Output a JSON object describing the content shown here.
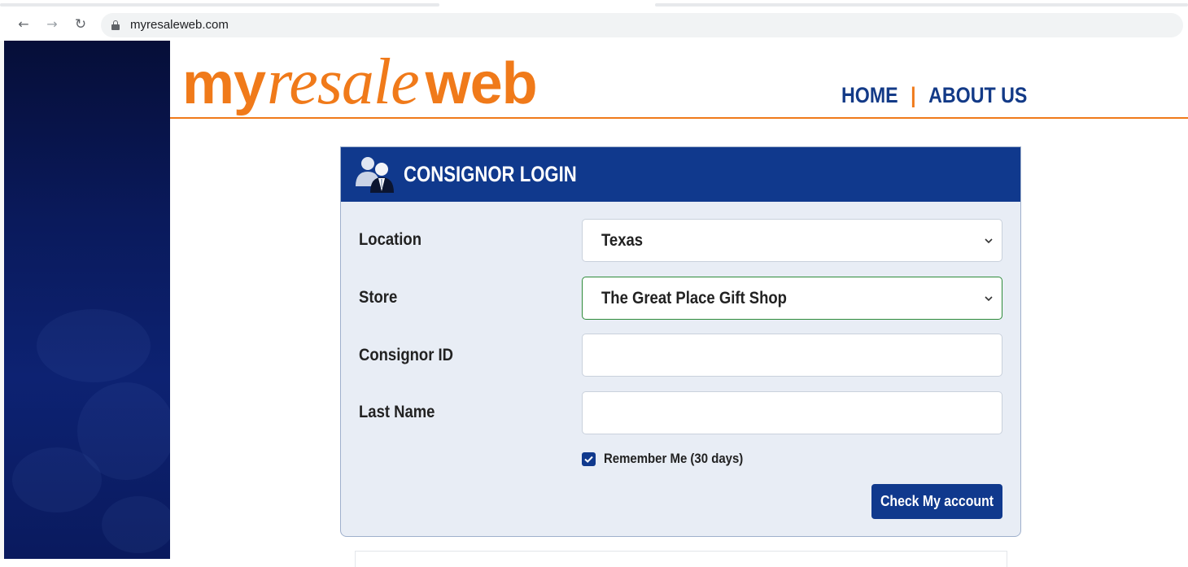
{
  "browser": {
    "url": "myresaleweb.com",
    "nav_icons": {
      "back": "back-arrow-icon",
      "forward": "forward-arrow-icon",
      "reload": "reload-icon",
      "lock": "lock-icon"
    }
  },
  "header": {
    "logo": {
      "part1": "my",
      "part2": "resale",
      "part3": "web"
    },
    "nav": {
      "home": "HOME",
      "separator": "|",
      "about": "ABOUT US"
    },
    "colors": {
      "brand_orange": "#f07a1a",
      "brand_blue": "#133a87"
    }
  },
  "login": {
    "title": "CONSIGNOR LOGIN",
    "icon": "users-icon",
    "location": {
      "label": "Location",
      "value": "Texas"
    },
    "store": {
      "label": "Store",
      "value": "The Great Place Gift Shop"
    },
    "consignor_id": {
      "label": "Consignor ID",
      "value": ""
    },
    "last_name": {
      "label": "Last Name",
      "value": ""
    },
    "remember": {
      "label": "Remember Me (30 days)",
      "checked": true
    },
    "submit_label": "Check My account",
    "colors": {
      "header_bg": "#10398d",
      "card_bg": "#e8edf5"
    }
  }
}
